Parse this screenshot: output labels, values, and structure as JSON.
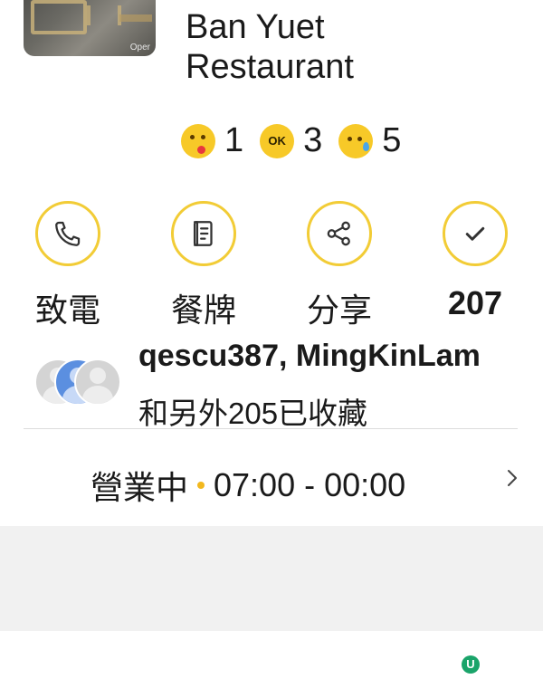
{
  "restaurant": {
    "name_line1": "Ban Yuet",
    "name_line2": "Restaurant",
    "photo_watermark": "Oper"
  },
  "ratings": [
    {
      "icon": "smile-emoji-icon",
      "count": "1"
    },
    {
      "icon": "ok-emoji-icon",
      "count": "3",
      "label": "OK"
    },
    {
      "icon": "sad-emoji-icon",
      "count": "5"
    }
  ],
  "actions": [
    {
      "icon": "phone-icon",
      "label": "致電"
    },
    {
      "icon": "menu-icon",
      "label": "餐牌"
    },
    {
      "icon": "share-icon",
      "label": "分享"
    },
    {
      "icon": "check-icon",
      "label": "207"
    }
  ],
  "collectors": {
    "names": "qescu387, MingKinLam",
    "subtitle": "和另外205已收藏"
  },
  "hours": {
    "status": "營業中",
    "range": "07:00 - 00:00"
  },
  "footer": {
    "badge_text": "U"
  },
  "colors": {
    "accent": "#f2cc36",
    "emoji": "#f7c928",
    "badge": "#1aa46a"
  }
}
